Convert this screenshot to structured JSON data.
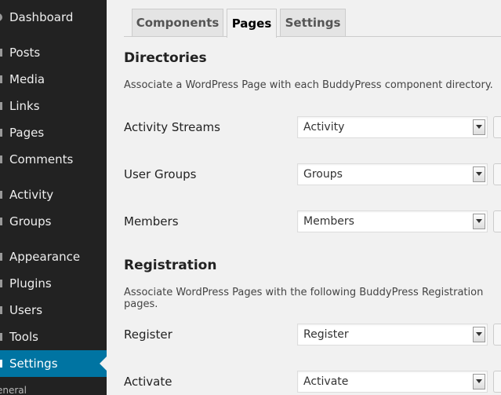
{
  "sidebar": {
    "items": [
      {
        "label": "Dashboard",
        "icon": "dashboard-icon",
        "active": false
      },
      {
        "label": "Posts",
        "icon": "posts-icon",
        "active": false
      },
      {
        "label": "Media",
        "icon": "media-icon",
        "active": false
      },
      {
        "label": "Links",
        "icon": "links-icon",
        "active": false
      },
      {
        "label": "Pages",
        "icon": "pages-icon",
        "active": false
      },
      {
        "label": "Comments",
        "icon": "comments-icon",
        "active": false
      },
      {
        "label": "Activity",
        "icon": "activity-icon",
        "active": false
      },
      {
        "label": "Groups",
        "icon": "groups-icon",
        "active": false
      },
      {
        "label": "Appearance",
        "icon": "appearance-icon",
        "active": false
      },
      {
        "label": "Plugins",
        "icon": "plugins-icon",
        "active": false
      },
      {
        "label": "Users",
        "icon": "users-icon",
        "active": false
      },
      {
        "label": "Tools",
        "icon": "tools-icon",
        "active": false
      },
      {
        "label": "Settings",
        "icon": "settings-icon",
        "active": true
      }
    ],
    "submenu_peek": "eneral",
    "colors": {
      "background": "#222222",
      "active": "#0074a2",
      "text": "#eeeeee"
    }
  },
  "tabs": [
    {
      "label": "Components",
      "active": false
    },
    {
      "label": "Pages",
      "active": true
    },
    {
      "label": "Settings",
      "active": false
    }
  ],
  "directories": {
    "title": "Directories",
    "description": "Associate a WordPress Page with each BuddyPress component directory.",
    "rows": [
      {
        "label": "Activity Streams",
        "selected": "Activity"
      },
      {
        "label": "User Groups",
        "selected": "Groups"
      },
      {
        "label": "Members",
        "selected": "Members"
      }
    ]
  },
  "registration": {
    "title": "Registration",
    "description": "Associate WordPress Pages with the following BuddyPress Registration pages.",
    "rows": [
      {
        "label": "Register",
        "selected": "Register"
      },
      {
        "label": "Activate",
        "selected": "Activate"
      }
    ]
  }
}
